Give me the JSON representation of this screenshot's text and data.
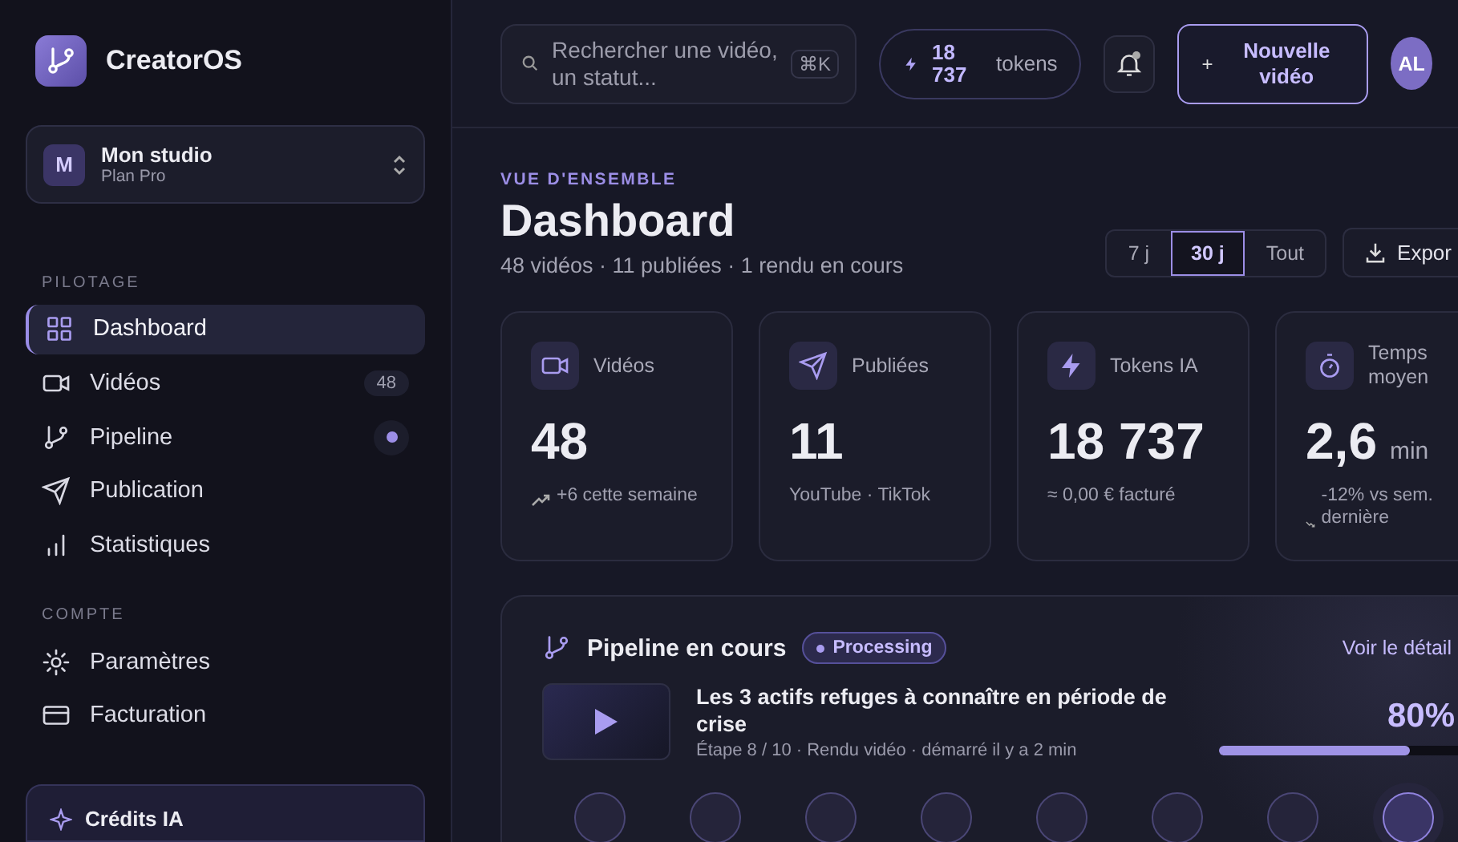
{
  "brand": {
    "name": "CreatorOS"
  },
  "workspace": {
    "initial": "M",
    "name": "Mon studio",
    "plan": "Plan Pro"
  },
  "nav_sections": [
    {
      "title": "PILOTAGE",
      "items": [
        {
          "label": "Dashboard",
          "selected": true
        },
        {
          "label": "Vidéos",
          "selected": false,
          "badge": "48"
        },
        {
          "label": "Pipeline",
          "selected": false,
          "dot": true
        },
        {
          "label": "Publication",
          "selected": false
        },
        {
          "label": "Statistiques",
          "selected": false
        }
      ]
    },
    {
      "title": "COMPTE",
      "items": [
        {
          "label": "Paramètres",
          "selected": false
        },
        {
          "label": "Facturation",
          "selected": false
        }
      ]
    }
  ],
  "credits_card": {
    "title": "Crédits IA"
  },
  "topbar": {
    "search": {
      "placeholder": "Rechercher une vidéo, un statut...",
      "shortcut": "⌘K"
    },
    "tokens": {
      "value": "18 737",
      "label": "tokens"
    },
    "notifications": {
      "unread": true
    },
    "new_button": {
      "icon": "+",
      "label": "Nouvelle vidéo"
    },
    "avatar": {
      "initials": "AL"
    }
  },
  "overview": {
    "eyebrow": "VUE D'ENSEMBLE",
    "title": "Dashboard",
    "subtitle": "48 vidéos · 11 publiées · 1 rendu en cours",
    "ranges": [
      {
        "label": "7 j",
        "selected": false
      },
      {
        "label": "30 j",
        "selected": true
      },
      {
        "label": "Tout",
        "selected": false
      }
    ],
    "export_label": "Expor"
  },
  "stats": [
    {
      "label": "Vidéos",
      "value": "48",
      "note": "+6 cette semaine",
      "kind": "rising"
    },
    {
      "label": "Publiées",
      "value": "11",
      "note": "YouTube · TikTok"
    },
    {
      "label": "Tokens IA",
      "value": "18 737",
      "note": "≈ 0,00 € facturé"
    },
    {
      "label": "Temps moyen",
      "value": "2,6",
      "unit": "min",
      "note": "-12% vs sem. dernière",
      "kind": "falling"
    }
  ],
  "pipeline": {
    "title": "Pipeline en cours",
    "status": "Processing",
    "link": "Voir le détail",
    "video_title": "Les 3 actifs refuges à connaître en période de crise",
    "meta": "Étape 8 / 10 · Rendu vidéo · démarré il y a 2 min",
    "percent": "80%",
    "level": 0.8,
    "steps": [
      {
        "current": false
      },
      {
        "current": false
      },
      {
        "current": false
      },
      {
        "current": false
      },
      {
        "current": false
      },
      {
        "current": false
      },
      {
        "current": false
      },
      {
        "current": true
      }
    ]
  }
}
